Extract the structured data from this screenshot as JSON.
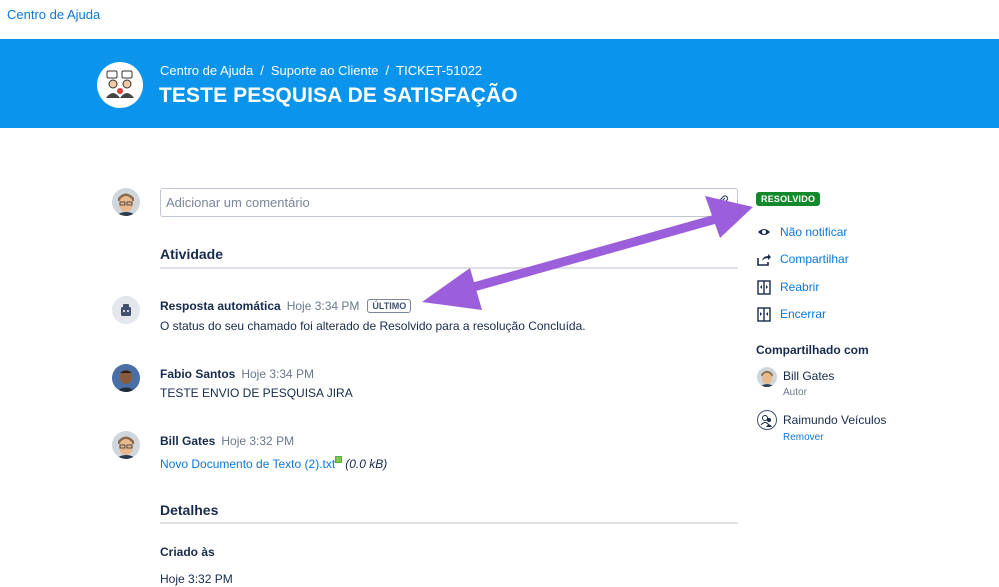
{
  "topbar": {
    "help_center": "Centro de Ajuda"
  },
  "header": {
    "breadcrumb": [
      "Centro de Ajuda",
      "Suporte ao Cliente",
      "TICKET-51022"
    ],
    "title": "TESTE PESQUISA DE SATISFAÇÃO"
  },
  "comment": {
    "placeholder": "Adicionar um comentário"
  },
  "activity": {
    "heading": "Atividade",
    "items": [
      {
        "author": "Resposta automática",
        "time": "Hoje 3:34 PM",
        "badge": "ÚLTIMO",
        "body": "O status do seu chamado foi alterado de Resolvido para a resolução Concluída."
      },
      {
        "author": "Fabio Santos",
        "time": "Hoje 3:34 PM",
        "body": "TESTE ENVIO DE PESQUISA JIRA"
      },
      {
        "author": "Bill Gates",
        "time": "Hoje 3:32 PM",
        "attachment": "Novo Documento de Texto (2).txt",
        "size": "(0.0 kB)"
      }
    ]
  },
  "details": {
    "heading": "Detalhes",
    "created_label": "Criado às",
    "created_value": "Hoje 3:32 PM"
  },
  "sidebar": {
    "status": "RESOLVIDO",
    "status_color": "#14892c",
    "actions": [
      {
        "label": "Não notificar",
        "icon": "eye-icon"
      },
      {
        "label": "Compartilhar",
        "icon": "share-icon"
      },
      {
        "label": "Reabrir",
        "icon": "reopen-icon"
      },
      {
        "label": "Encerrar",
        "icon": "close-request-icon"
      }
    ],
    "shared_heading": "Compartilhado com",
    "shared": [
      {
        "name": "Bill Gates",
        "sub": "Autor"
      },
      {
        "name": "Raimundo Veículos",
        "sub": "Remover"
      }
    ]
  },
  "colors": {
    "accent": "#0b94ec",
    "link": "#0b77d9",
    "annotation_arrow": "#9b5fdc"
  }
}
